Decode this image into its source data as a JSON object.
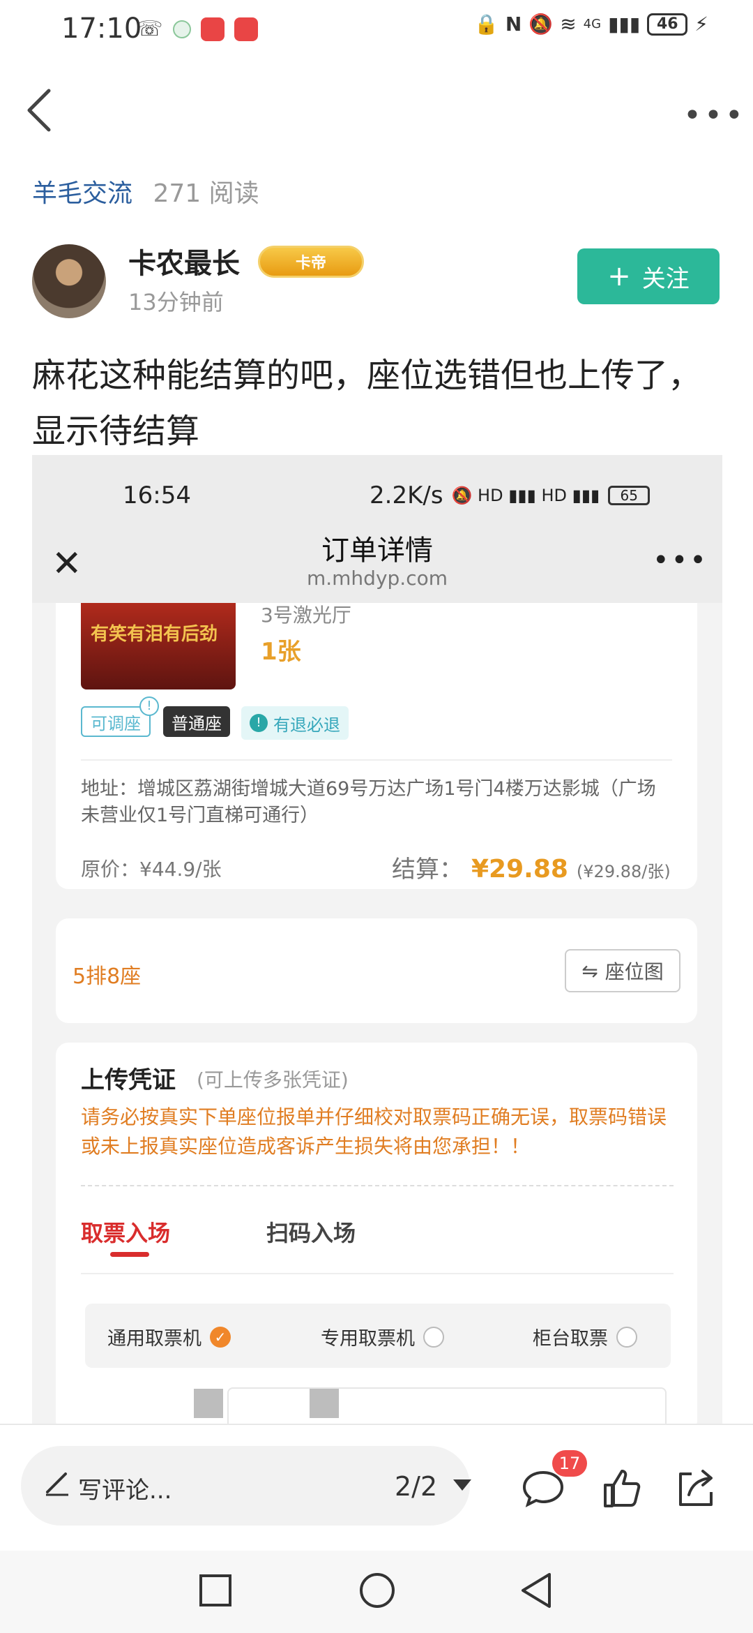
{
  "status_bar": {
    "time": "17:10",
    "network": "4G",
    "battery": "46"
  },
  "post": {
    "group": "羊毛交流",
    "read_count": "271 阅读",
    "author": "卡农最长",
    "author_badge": "卡帝",
    "time_ago": "13分钟前",
    "follow_label": "关注",
    "text": "麻花这种能结算的吧，座位选错但也上传了，显示待结算"
  },
  "screenshot": {
    "status_time": "16:54",
    "status_speed": "2.2K/s",
    "battery": "65",
    "title": "订单详情",
    "domain": "m.mhdyp.com",
    "poster_text": "有笑有泪有后劲",
    "hall": "3号激光厅",
    "quantity": "1张",
    "tags": [
      "可调座",
      "普通座",
      "有退必退"
    ],
    "address": "地址：增城区荔湖街增城大道69号万达广场1号门4楼万达影城（广场未营业仅1号门直梯可通行）",
    "original_price": "原价：¥44.9/张",
    "settle_label": "结算：",
    "settle_price": "¥29.88",
    "settle_unit": "(¥29.88/张)",
    "seat": "5排8座",
    "seat_map_label": "座位图",
    "upload_title": "上传凭证",
    "upload_sub": "(可上传多张凭证)",
    "warning": "请务必按真实下单座位报单并仔细校对取票码正确无误，取票码错误或未上报真实座位造成客诉产生损失将由您承担！！",
    "tabs": [
      "取票入场",
      "扫码入场"
    ],
    "options": [
      "通用取票机",
      "专用取票机",
      "柜台取票"
    ]
  },
  "bottom_bar": {
    "comment_placeholder": "写评论...",
    "page_indicator": "2/2",
    "comment_count": "17"
  },
  "colors": {
    "accent": "#2cb899",
    "settle": "#e89a20",
    "tab_active": "#d92d2d",
    "link": "#2b5e9e"
  }
}
